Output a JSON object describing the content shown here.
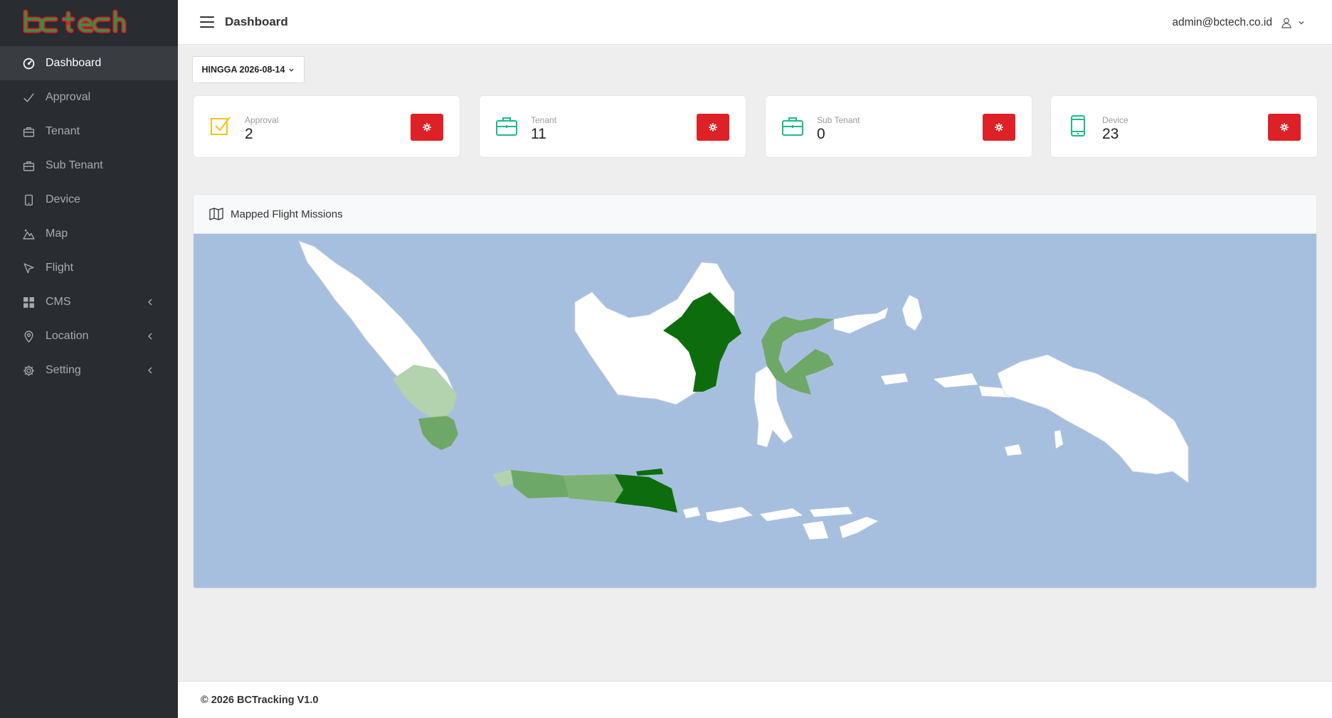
{
  "brand": {
    "logo_text": "bctech",
    "primary_color": "#1f9d45",
    "accent_color": "#dd2127"
  },
  "sidebar": {
    "items": [
      {
        "label": "Dashboard",
        "icon": "dashboard-icon",
        "active": true
      },
      {
        "label": "Approval",
        "icon": "check-icon"
      },
      {
        "label": "Tenant",
        "icon": "briefcase-icon"
      },
      {
        "label": "Sub Tenant",
        "icon": "briefcase-icon"
      },
      {
        "label": "Device",
        "icon": "mobile-icon"
      },
      {
        "label": "Map",
        "icon": "map-mountain-icon"
      },
      {
        "label": "Flight",
        "icon": "cursor-icon"
      },
      {
        "label": "CMS",
        "icon": "grid-icon",
        "expandable": true
      },
      {
        "label": "Location",
        "icon": "location-pin-icon",
        "expandable": true
      },
      {
        "label": "Setting",
        "icon": "gear-icon",
        "expandable": true
      }
    ]
  },
  "header": {
    "title": "Dashboard",
    "user_email": "admin@bctech.co.id"
  },
  "filter": {
    "label": "HINGGA 2026-08-14"
  },
  "stats": [
    {
      "label": "Approval",
      "value": "2",
      "icon": "checkbox-icon",
      "icon_color": "#f0c419"
    },
    {
      "label": "Tenant",
      "value": "11",
      "icon": "briefcase-icon",
      "icon_color": "#1fb88c"
    },
    {
      "label": "Sub Tenant",
      "value": "0",
      "icon": "briefcase-icon",
      "icon_color": "#1fb88c"
    },
    {
      "label": "Device",
      "value": "23",
      "icon": "mobile-icon",
      "icon_color": "#1fb88c"
    }
  ],
  "map": {
    "title": "Mapped Flight Missions",
    "ocean_color": "#a7bfdf",
    "land_color": "#ffffff",
    "highlight_colors": [
      "#b2d3ae",
      "#6ea866",
      "#7cb373",
      "#0d6d0d"
    ]
  },
  "footer": {
    "text": "© 2026 BCTracking V1.0"
  }
}
